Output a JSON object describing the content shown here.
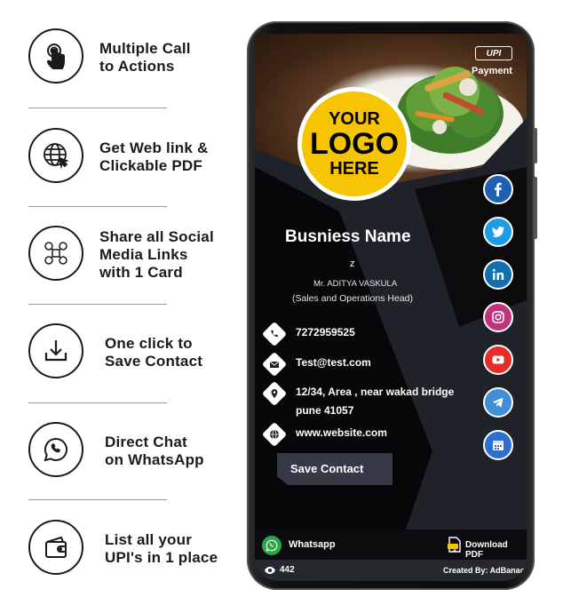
{
  "features": [
    {
      "icon": "touch-hand-icon",
      "lines": [
        "Multiple Call",
        "to Actions"
      ]
    },
    {
      "icon": "web-globe-icon",
      "lines": [
        "Get Web link &",
        "Clickable PDF"
      ]
    },
    {
      "icon": "social-network-icon",
      "lines": [
        "Share all Social",
        "Media Links",
        "with 1 Card"
      ]
    },
    {
      "icon": "download-icon",
      "lines": [
        "One click to",
        "Save Contact"
      ]
    },
    {
      "icon": "whatsapp-icon",
      "lines": [
        "Direct Chat",
        "on WhatsApp"
      ]
    },
    {
      "icon": "wallet-icon",
      "lines": [
        "List all your",
        "UPI's in 1 place"
      ]
    }
  ],
  "card": {
    "upi_badge": "UPI",
    "payment_label": "Payment",
    "logo": {
      "line1": "YOUR",
      "line2": "LOGO",
      "line3": "HERE"
    },
    "business_name": "Busniess Name",
    "tagline": "z",
    "person_name": "Mr. ADITYA VASKULA",
    "role": "(Sales and Operations Head)",
    "phone": "7272959525",
    "email": "Test@test.com",
    "address": "12/34, Area , near wakad bridge pune 41057",
    "website": "www.website.com",
    "save_contact": "Save Contact",
    "socials": [
      {
        "icon": "facebook-icon",
        "color": "#1f5fb4"
      },
      {
        "icon": "twitter-icon",
        "color": "#1e9be6"
      },
      {
        "icon": "linkedin-icon",
        "color": "#0f6fb0"
      },
      {
        "icon": "instagram-icon",
        "color": "#c1337f"
      },
      {
        "icon": "youtube-icon",
        "color": "#e52d27"
      },
      {
        "icon": "telegram-icon",
        "color": "#3f8fd8"
      },
      {
        "icon": "calendar-icon",
        "color": "#2b6fd1"
      }
    ],
    "whatsapp_label": "Whatsapp",
    "download_pdf": "Download PDF",
    "views": "442",
    "created_by": "Created By: AdBanao"
  }
}
